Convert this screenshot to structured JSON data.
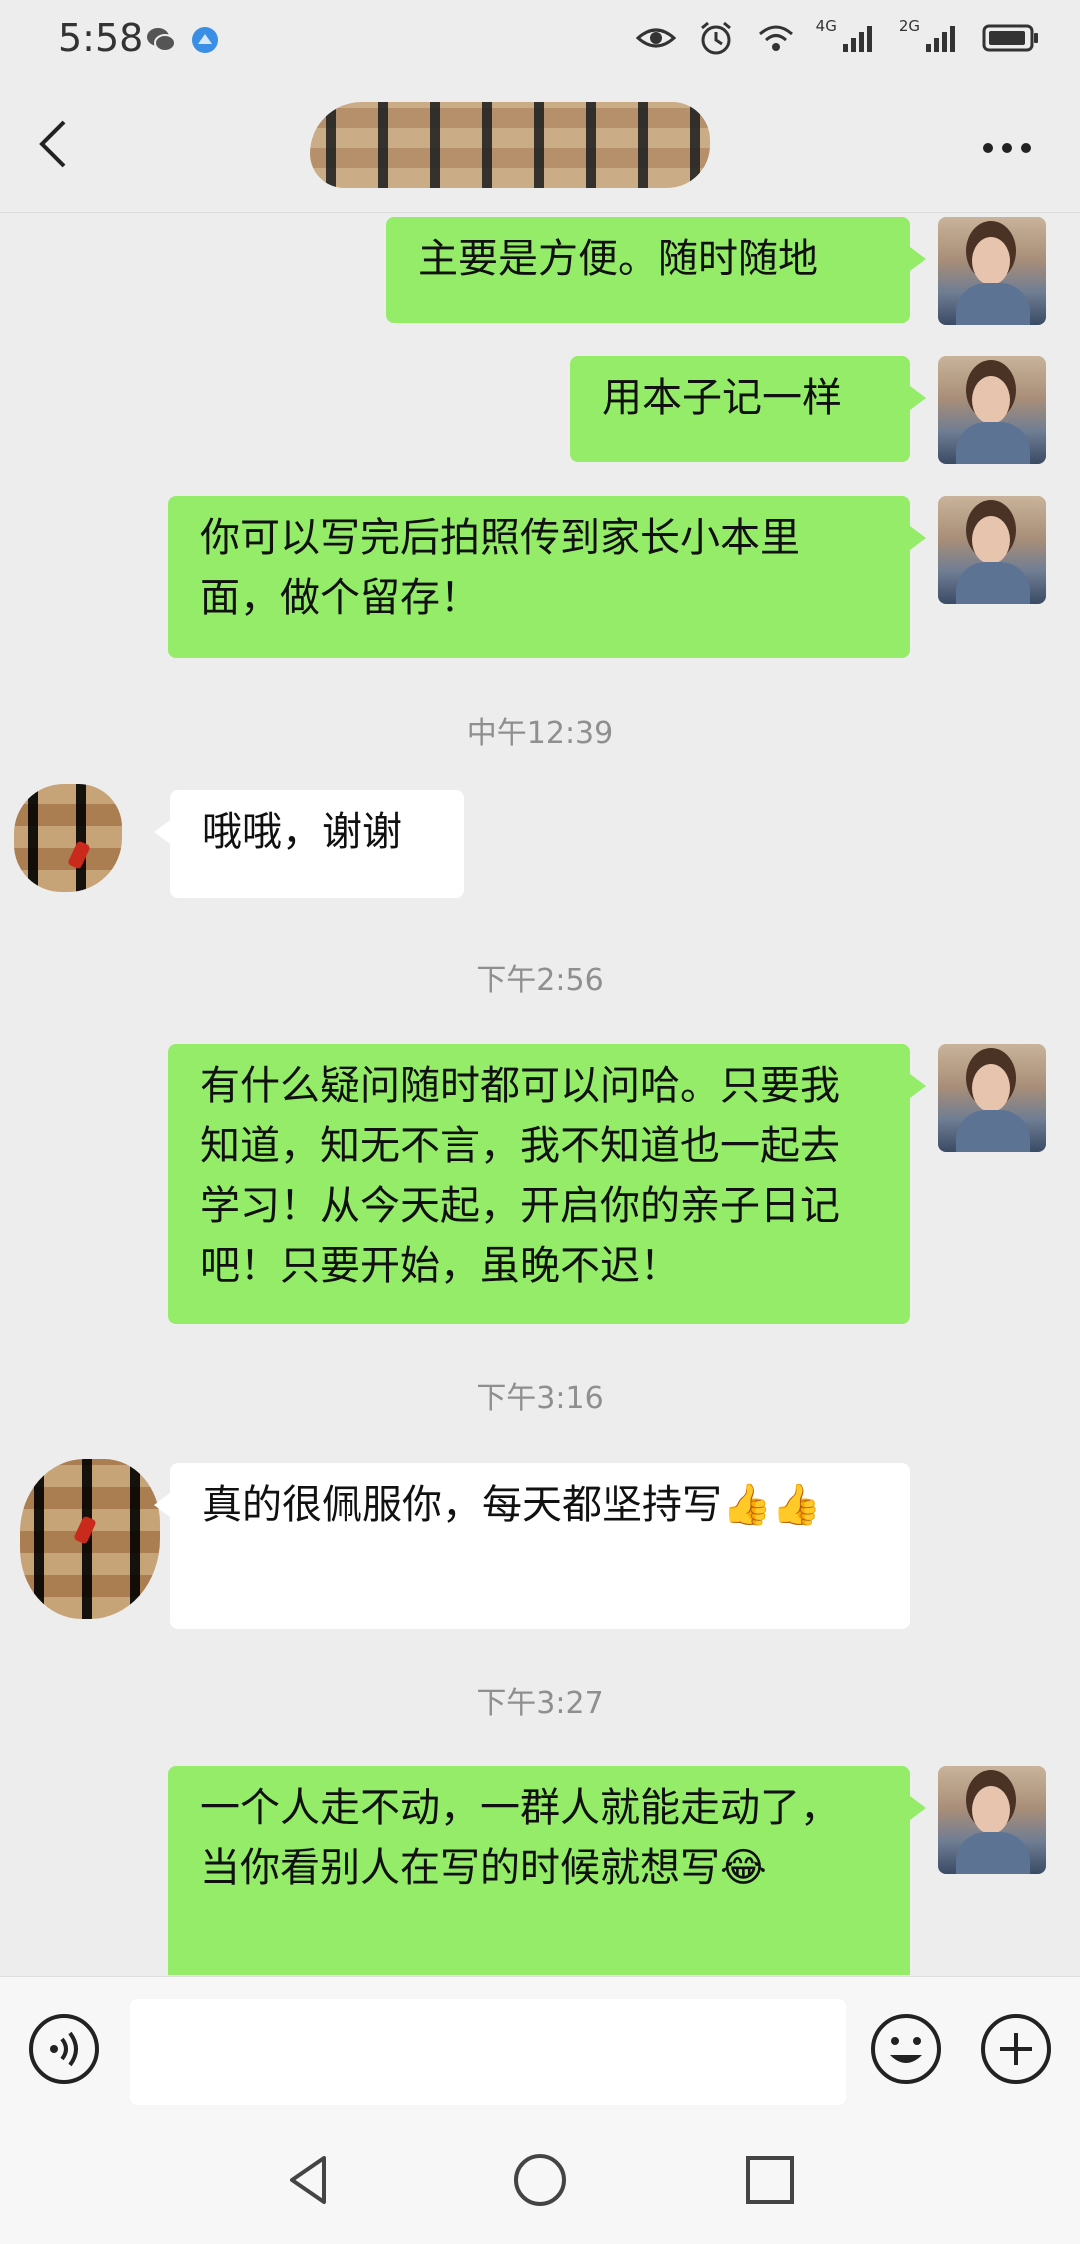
{
  "status_bar": {
    "time": "5:58",
    "left_icons": [
      "wechat-icon",
      "browser-icon"
    ],
    "right_icons": [
      "eye-icon",
      "alarm-icon",
      "wifi-icon",
      "signal-4g-icon",
      "signal-2g-icon",
      "battery-icon"
    ],
    "network_labels": [
      "4G",
      "2G"
    ]
  },
  "header": {
    "title": "",
    "back_icon": "chevron-left-icon",
    "more_icon": "more-dots-icon"
  },
  "messages": [
    {
      "type": "message",
      "sender": "self",
      "text": "主要是方便。随时随地"
    },
    {
      "type": "message",
      "sender": "self",
      "text": "用本子记一样"
    },
    {
      "type": "message",
      "sender": "self",
      "text": "你可以写完后拍照传到家长小本里面，做个留存！"
    },
    {
      "type": "timestamp",
      "text": "中午12:39"
    },
    {
      "type": "message",
      "sender": "other",
      "text": "哦哦，谢谢"
    },
    {
      "type": "timestamp",
      "text": "下午2:56"
    },
    {
      "type": "message",
      "sender": "self",
      "text": "有什么疑问随时都可以问哈。只要我知道，知无不言，我不知道也一起去学习！从今天起，开启你的亲子日记吧！只要开始，虽晚不迟！"
    },
    {
      "type": "timestamp",
      "text": "下午3:16"
    },
    {
      "type": "message",
      "sender": "other",
      "text": "真的很佩服你，每天都坚持写👍👍"
    },
    {
      "type": "timestamp",
      "text": "下午3:27"
    },
    {
      "type": "message",
      "sender": "self",
      "text": "一个人走不动，一群人就能走动了，当你看别人在写的时候就想写😂"
    }
  ],
  "input_bar": {
    "text_value": "",
    "voice_icon": "voice-icon",
    "emoji_icon": "emoji-icon",
    "plus_icon": "plus-icon"
  },
  "nav_bar": {
    "icons": [
      "back-triangle-icon",
      "home-circle-icon",
      "recents-square-icon"
    ]
  },
  "colors": {
    "background": "#ededed",
    "self_bubble": "#95ec69",
    "other_bubble": "#ffffff",
    "timestamp_text": "#8f8f8f"
  }
}
